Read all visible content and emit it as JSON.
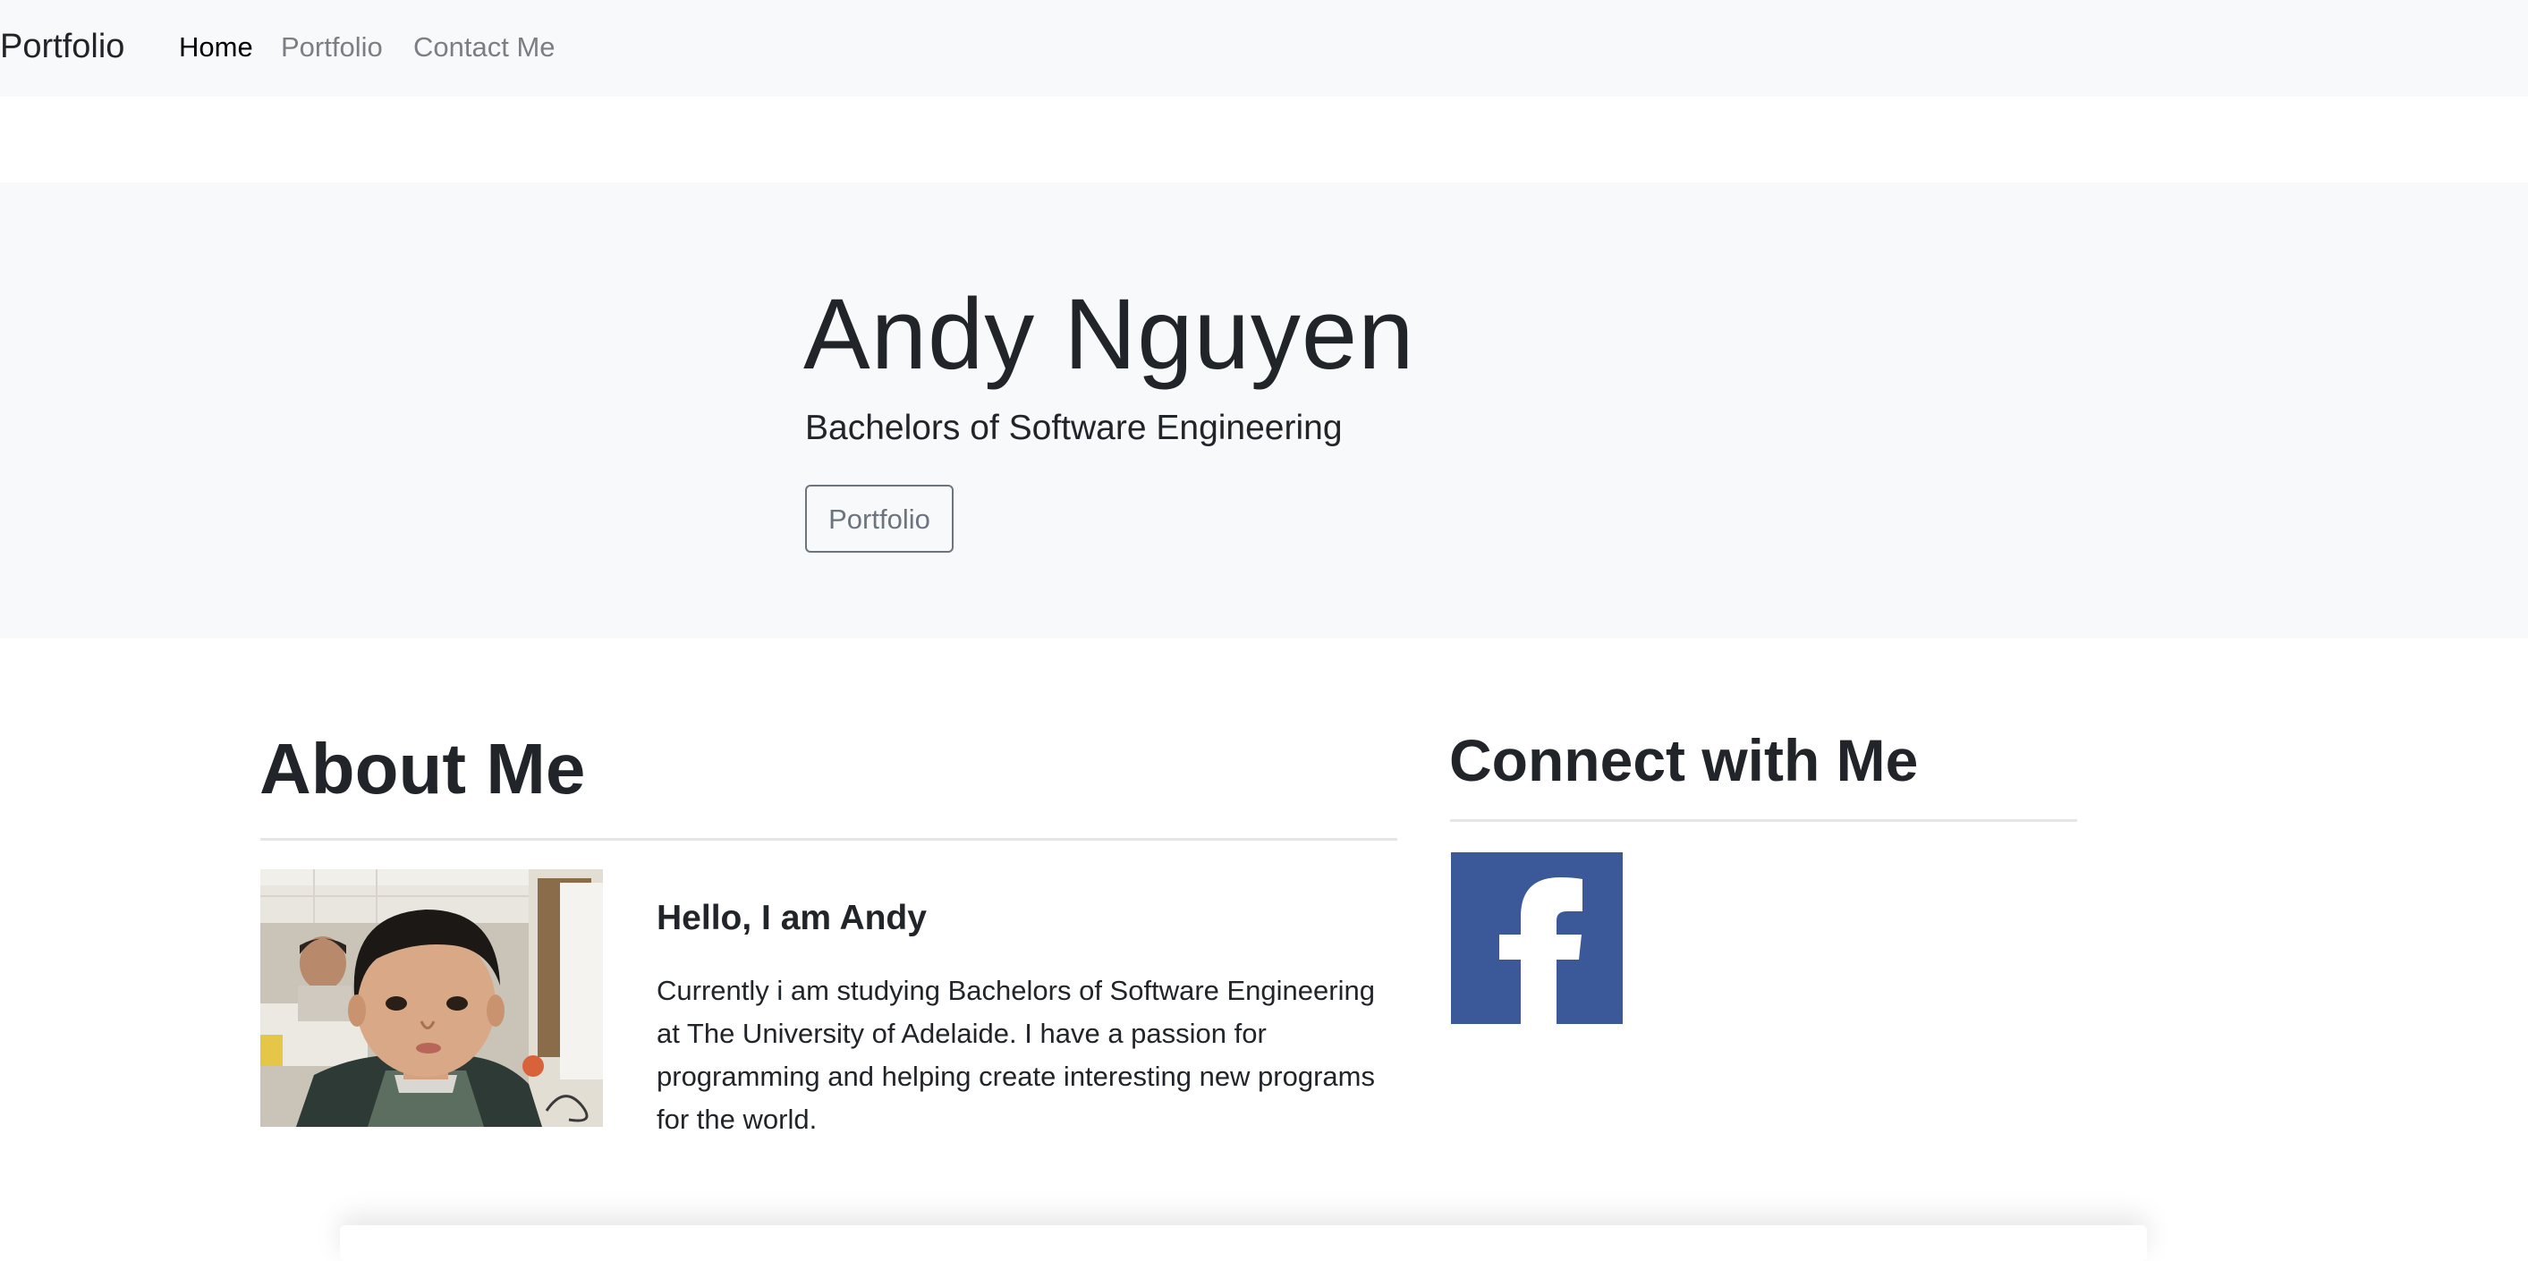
{
  "navbar": {
    "brand": "Portfolio",
    "links": [
      {
        "label": "Home",
        "active": true
      },
      {
        "label": "Portfolio",
        "active": false
      },
      {
        "label": "Contact Me",
        "active": false
      }
    ]
  },
  "hero": {
    "title": "Andy Nguyen",
    "subtitle": "Bachelors of Software Engineering",
    "button_label": "Portfolio"
  },
  "about": {
    "title": "About Me",
    "greeting": "Hello, I am Andy",
    "bio": "Currently i am studying Bachelors of Software Engineering at The University of Adelaide. I have a passion for programming and helping create interesting new programs for the world."
  },
  "connect": {
    "title": "Connect with Me",
    "social": [
      {
        "icon": "facebook-icon",
        "color": "#3b5998"
      }
    ]
  },
  "colors": {
    "navbar_bg": "#f8f9fa",
    "hero_bg": "#f8f9fa",
    "text": "#212529",
    "muted": "#6c757d",
    "facebook": "#3b5998"
  }
}
